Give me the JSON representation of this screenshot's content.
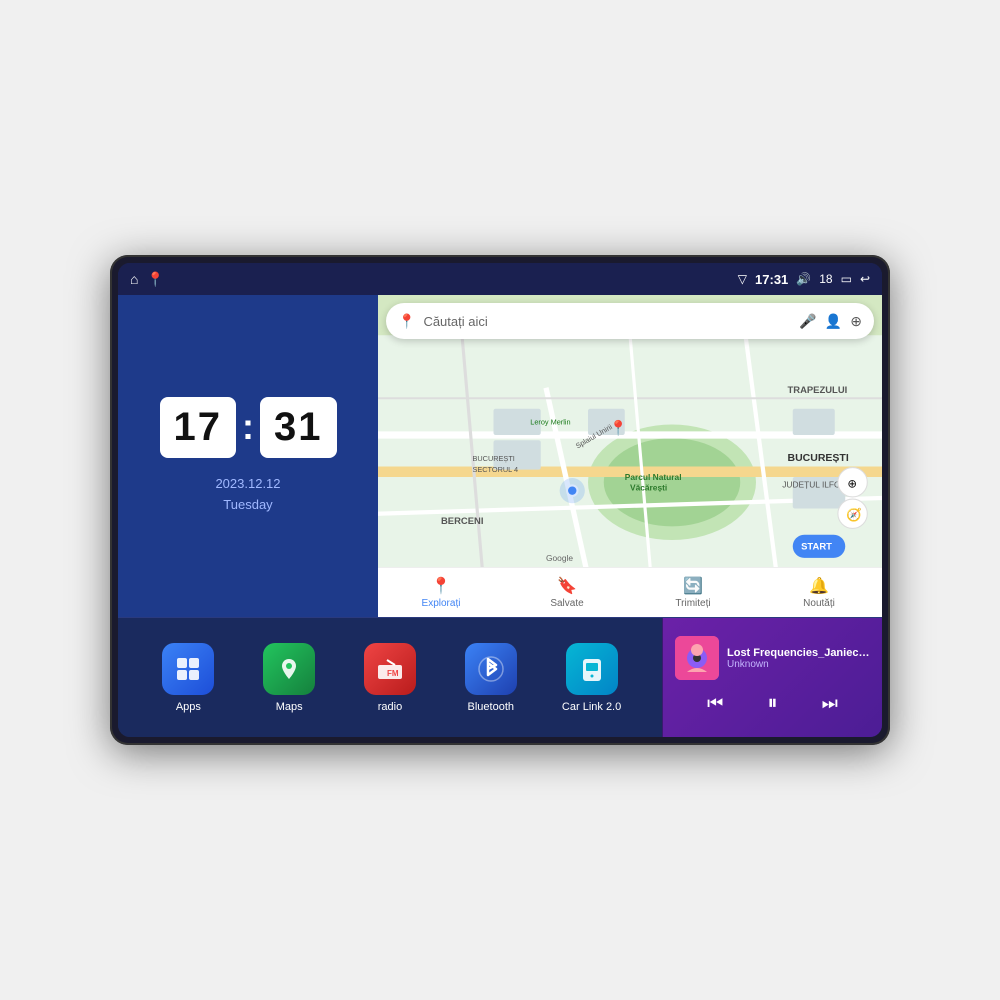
{
  "device": {
    "status_bar": {
      "left_icons": [
        "home-icon",
        "maps-status-icon"
      ],
      "signal_icon": "▽",
      "time": "17:31",
      "volume_icon": "🔊",
      "battery_level": "18",
      "battery_icon": "🔋",
      "back_icon": "↩"
    },
    "clock": {
      "hours": "17",
      "minutes": "31",
      "date": "2023.12.12",
      "day": "Tuesday"
    },
    "map": {
      "search_placeholder": "Căutați aici",
      "nav_items": [
        {
          "label": "Explorați",
          "icon": "📍",
          "active": true
        },
        {
          "label": "Salvate",
          "icon": "🔖",
          "active": false
        },
        {
          "label": "Trimiteți",
          "icon": "🔄",
          "active": false
        },
        {
          "label": "Noutăți",
          "icon": "🔔",
          "active": false
        }
      ],
      "labels": [
        "TRAPEZULUI",
        "BUCUREȘTI",
        "JUDEȚUL ILFOV",
        "BERCENI",
        "BUCUREȘTI SECTORUL 4",
        "Parcul Natural Văcărești",
        "Leroy Merlin",
        "Google"
      ]
    },
    "apps": [
      {
        "label": "Apps",
        "icon": "⊞",
        "color_class": "app-icon-apps"
      },
      {
        "label": "Maps",
        "icon": "🗺",
        "color_class": "app-icon-maps"
      },
      {
        "label": "radio",
        "icon": "📻",
        "color_class": "app-icon-radio"
      },
      {
        "label": "Bluetooth",
        "icon": "⬡",
        "color_class": "app-icon-bluetooth"
      },
      {
        "label": "Car Link 2.0",
        "icon": "📱",
        "color_class": "app-icon-carlink"
      }
    ],
    "music": {
      "title": "Lost Frequencies_Janieck Devy-...",
      "artist": "Unknown",
      "prev_icon": "⏮",
      "play_pause_icon": "⏸",
      "next_icon": "⏭"
    }
  }
}
